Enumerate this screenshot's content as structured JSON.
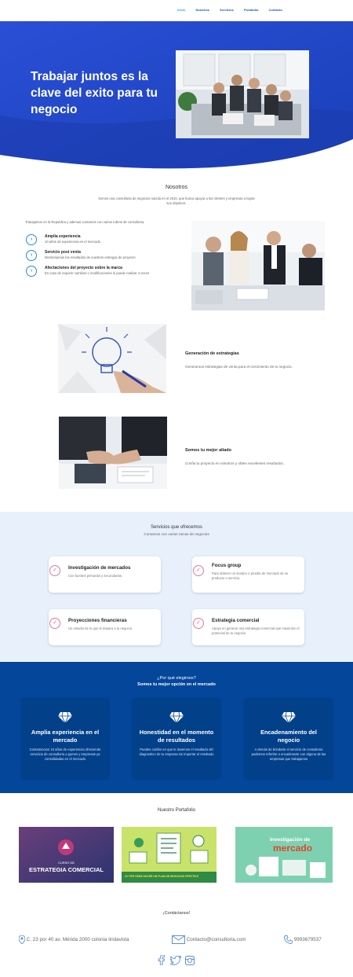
{
  "nav": {
    "items": [
      {
        "label": "Inicio",
        "active": true
      },
      {
        "label": "Nosotros",
        "active": false
      },
      {
        "label": "Servicios",
        "active": false
      },
      {
        "label": "Portafolio",
        "active": false
      },
      {
        "label": "Contacto",
        "active": false
      }
    ]
  },
  "hero": {
    "title": "Trabajar juntos es la clave del exito para tu negocio"
  },
  "about": {
    "title": "Nosotros",
    "subtitle": "Somos una consultoria de negocios nacida en el 2010, que busca apoyar a los clientes y empresas a lograr sus objetivos.",
    "intro": "Trabajamos en la Republica y ademas contamos con varios rubros de consultoria.",
    "features": [
      {
        "title": "Amplia experiencia",
        "desc": "10 años de experiencia en el mercado"
      },
      {
        "title": "Servicio post venta",
        "desc": "Monitoriamos los resultados de nuestros entregas de proyecto"
      },
      {
        "title": "Afectaciones del proyecto sobre la marca",
        "desc": "En caso de requerir cambios o modificaciones  lo puede realizar 3 veces"
      }
    ],
    "rows": [
      {
        "title": "Generación de estrategias",
        "desc": "Generamos estrategias de venta para el crecimiento de tu negocio."
      },
      {
        "title": "Somos tu mejor aliado",
        "desc": "Confia tu proyecto en nosotros  y obten excelentes resultados."
      }
    ]
  },
  "services": {
    "title": "Servicios que ofrecemos",
    "subtitle": "Contamos con varias ramas de negocios",
    "items": [
      {
        "title": "Investigación de mercados",
        "desc": "Con fuentes primarias y secundarias."
      },
      {
        "title": "Focus group",
        "desc": "Para obtener un sondeo o prueba de mercado de su producto o servicio."
      },
      {
        "title": "Proyecciones financieras",
        "desc": "Un estudio de lo que le depara a tu negocio."
      },
      {
        "title": "Estrategia comercial",
        "desc": "Apoyo en generar una estrategia comercial que maximize el potencial de tu negocio."
      }
    ]
  },
  "why": {
    "title": "¿Por qué elegirnos?",
    "subtitle": "Somos tu mejor opción en el mercado",
    "cards": [
      {
        "title": "Amplia experiencia en el mercado",
        "desc": "Contamincion 10 años de experiencia ofreciendo servicios de consultoria a pymes y empresas ya consolidadas en el mercado"
      },
      {
        "title": "Honestidad en el momento de resultados",
        "desc": "Puedes confiar en que te daremos el resultado del diagnostico de tu empresa sin importar el resultado"
      },
      {
        "title": "Encadenamiento del negocio",
        "desc": "A demás de brindarte el servicio de consultoria podemos referirte o encadenarte con alguna de las empresas que trabajamos"
      }
    ]
  },
  "portfolio": {
    "title": "Nuestro Portafolio",
    "items": [
      {
        "top": "CURSO DE",
        "main": "ESTRATEGIA COMERCIAL"
      },
      {
        "main": "10 TIPS PARA HACER UN PLAN DE NEGOCIOS EFECTIVO"
      },
      {
        "top": "Investigación de",
        "main": "mercado"
      }
    ]
  },
  "contact": {
    "title": "¡Contáctanos!",
    "address": "C. 23 por 40 av. Mérida 2000 colonia lindavista",
    "email": "Contacto@consultoria.com",
    "phone": "9993679537"
  },
  "colors": {
    "brand_blue": "#1e50d0",
    "dark_blue": "#03469a",
    "light_bg": "#e7f0fb",
    "accent_pink": "#e05a80"
  }
}
